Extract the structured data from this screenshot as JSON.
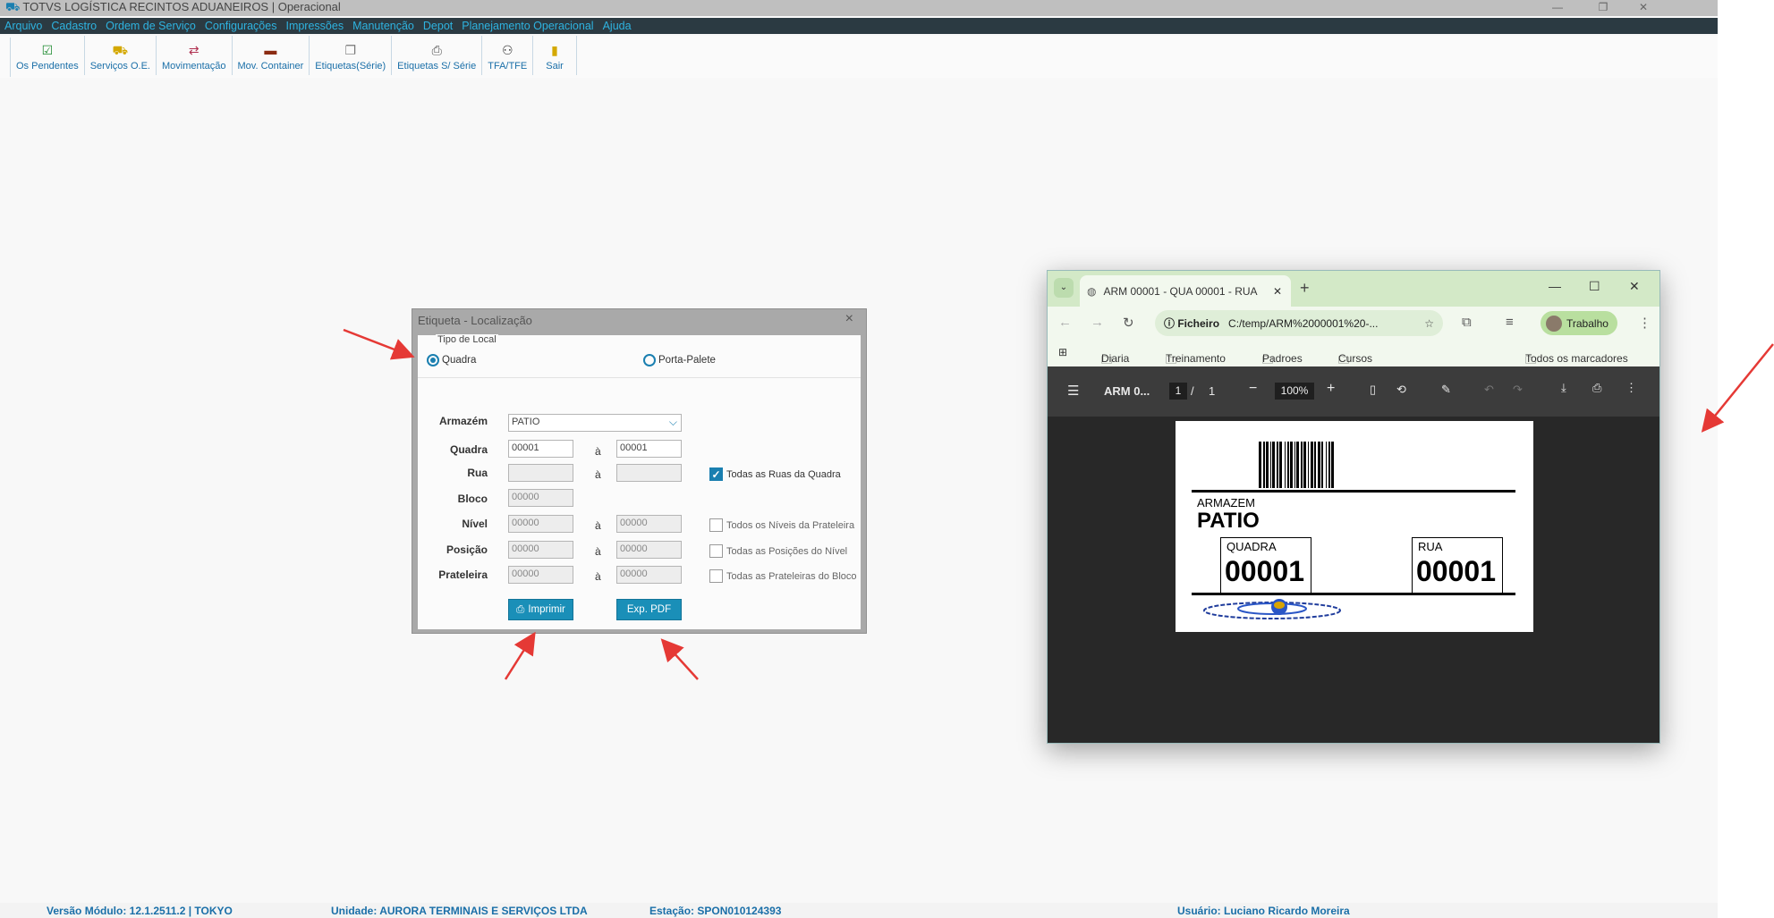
{
  "window": {
    "title": "TOTVS LOGÍSTICA RECINTOS ADUANEIROS | Operacional",
    "minimize": "—",
    "restore": "❐",
    "close": "✕"
  },
  "menu": [
    "Arquivo",
    "Cadastro",
    "Ordem de Serviço",
    "Configurações",
    "Impressões",
    "Manutenção",
    "Depot",
    "Planejamento Operacional",
    "Ajuda"
  ],
  "toolbar": [
    {
      "label": "Os Pendentes",
      "icon": "checklist-icon"
    },
    {
      "label": "Serviços O.E.",
      "icon": "truck-icon"
    },
    {
      "label": "Movimentação",
      "icon": "move-icon"
    },
    {
      "label": "Mov. Container",
      "icon": "container-icon"
    },
    {
      "label": "Etiquetas(Série)",
      "icon": "labels-icon"
    },
    {
      "label": "Etiquetas S/ Série",
      "icon": "printer-icon"
    },
    {
      "label": "TFA/TFE",
      "icon": "people-icon"
    },
    {
      "label": "Sair",
      "icon": "exit-door-icon"
    }
  ],
  "dialog": {
    "title": "Etiqueta - Localização",
    "group_label": "Tipo de Local",
    "radio_quadra": "Quadra",
    "radio_porta_palete": "Porta-Palete",
    "selected_type": "Quadra",
    "separator": "à",
    "labels": {
      "armazem": "Armazém",
      "quadra": "Quadra",
      "rua": "Rua",
      "bloco": "Bloco",
      "nivel": "Nível",
      "posicao": "Posição",
      "prateleira": "Prateleira"
    },
    "values": {
      "armazem": "PATIO",
      "quadra_de": "00001",
      "quadra_ate": "00001",
      "rua_de": "",
      "rua_ate": "",
      "bloco": "00000",
      "nivel_de": "00000",
      "nivel_ate": "00000",
      "posicao_de": "00000",
      "posicao_ate": "00000",
      "prateleira_de": "00000",
      "prateleira_ate": "00000"
    },
    "checks": {
      "ruas": {
        "label": "Todas as Ruas da Quadra",
        "checked": true
      },
      "niveis": {
        "label": "Todos os Níveis da Prateleira",
        "checked": false
      },
      "posicoes": {
        "label": "Todas as Posições do Nível",
        "checked": false
      },
      "prateleiras": {
        "label": "Todas as Prateleiras do Bloco",
        "checked": false
      }
    },
    "buttons": {
      "imprimir": "Imprimir",
      "exp_pdf": "Exp. PDF"
    }
  },
  "browser": {
    "tab_title": "ARM 00001 - QUA 00001 - RUA",
    "chip": "Ficheiro",
    "url": "C:/temp/ARM%2000001%20-...",
    "profile": "Trabalho",
    "bookmarks": [
      "Diaria",
      "Treinamento",
      "Padroes",
      "Cursos"
    ],
    "all_bookmarks": "Todos os marcadores",
    "pdf": {
      "title": "ARM 0...",
      "page_current": "1",
      "page_sep": "/",
      "page_total": "1",
      "zoom": "100%"
    },
    "label": {
      "armazem_caption": "ARMAZEM",
      "armazem_value": "PATIO",
      "quadra_caption": "QUADRA",
      "quadra_value": "00001",
      "rua_caption": "RUA",
      "rua_value": "00001"
    }
  },
  "status": {
    "versao": "Versão Módulo:  12.1.2511.2  |  TOKYO",
    "unidade": "Unidade: AURORA TERMINAIS E SERVIÇOS LTDA",
    "estacao": "Estação: SPON010124393",
    "usuario": "Usuário: Luciano Ricardo Moreira"
  },
  "colors": {
    "menubar": "#2b3a42",
    "accent": "#1a8fb8",
    "arrow": "#e53935"
  }
}
